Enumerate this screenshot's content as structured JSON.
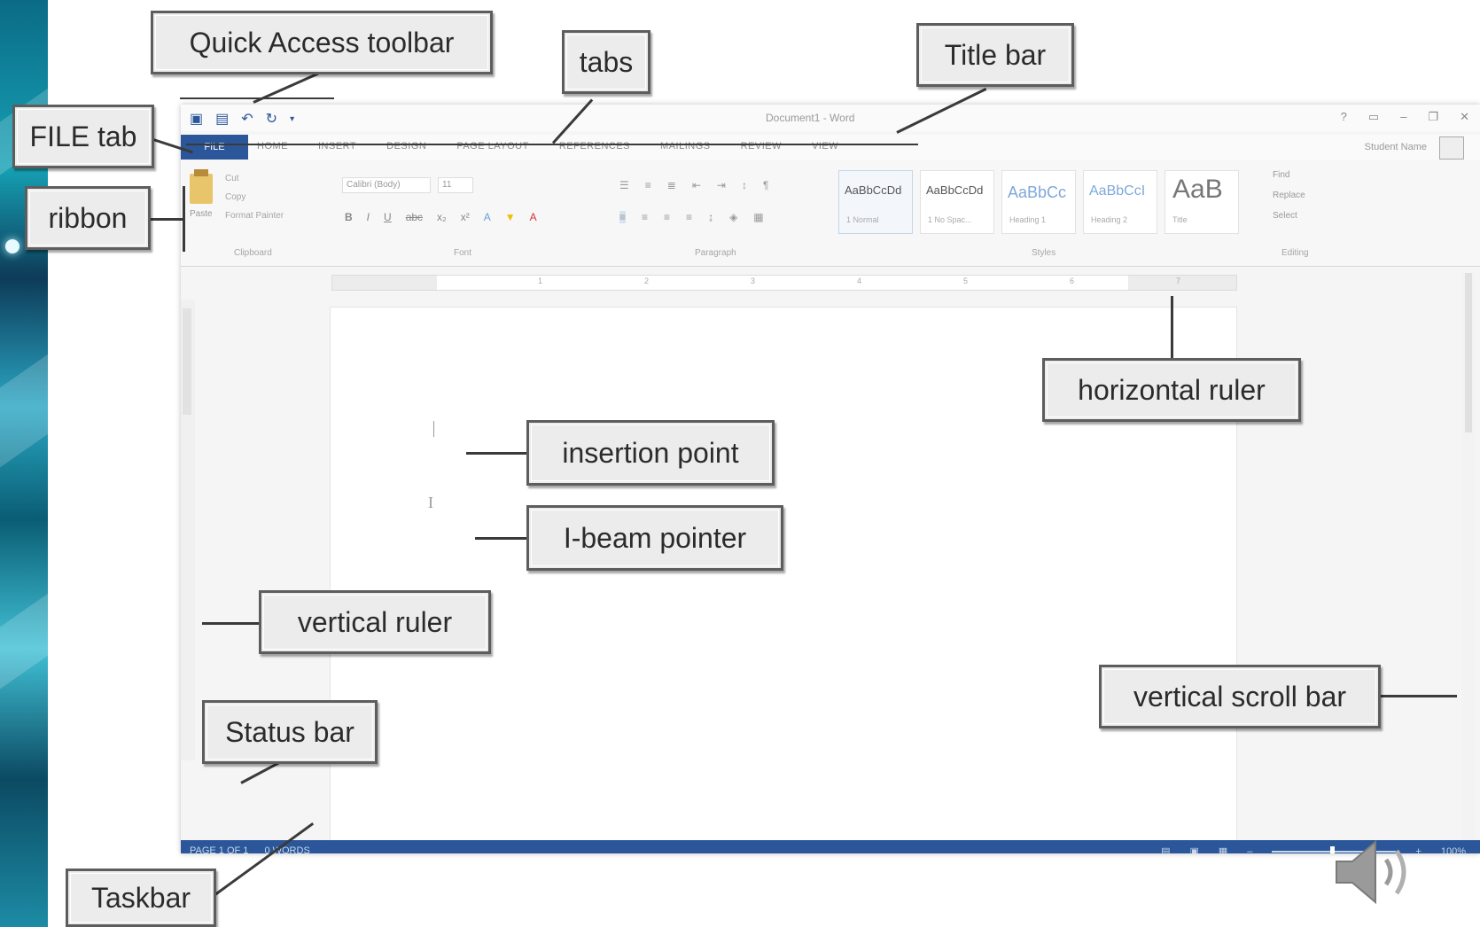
{
  "callouts": {
    "quick_access_toolbar": "Quick Access toolbar",
    "tabs": "tabs",
    "title_bar": "Title bar",
    "file_tab": "FILE tab",
    "ribbon": "ribbon",
    "horizontal_ruler": "horizontal ruler",
    "insertion_point": "insertion point",
    "ibeam_pointer": "I-beam pointer",
    "vertical_ruler": "vertical ruler",
    "vertical_scroll_bar": "vertical scroll bar",
    "status_bar": "Status bar",
    "taskbar": "Taskbar"
  },
  "word": {
    "title": "Document1 - Word",
    "file_tab": "FILE",
    "tabs": [
      "HOME",
      "INSERT",
      "DESIGN",
      "PAGE LAYOUT",
      "REFERENCES",
      "MAILINGS",
      "REVIEW",
      "VIEW"
    ],
    "user": "Student Name",
    "ribbon": {
      "paste": "Paste",
      "cut": "Cut",
      "copy": "Copy",
      "format_painter": "Format Painter",
      "font": "Calibri (Body)",
      "size": "11",
      "styles": [
        {
          "sample": "AaBbCcDd",
          "name": "1 Normal"
        },
        {
          "sample": "AaBbCcDd",
          "name": "1 No Spac..."
        },
        {
          "sample": "AaBbCc",
          "name": "Heading 1"
        },
        {
          "sample": "AaBbCcI",
          "name": "Heading 2"
        },
        {
          "sample": "AaB",
          "name": "Title"
        }
      ],
      "find": "Find",
      "replace": "Replace",
      "select": "Select",
      "groups": {
        "clipboard": "Clipboard",
        "font": "Font",
        "paragraph": "Paragraph",
        "styles": "Styles",
        "editing": "Editing"
      }
    },
    "ruler_numbers": [
      "1",
      "2",
      "3",
      "4",
      "5",
      "6",
      "7"
    ],
    "status": {
      "page": "PAGE 1 OF 1",
      "words": "0 WORDS",
      "zoom": "100%"
    }
  },
  "colors": {
    "word_blue": "#2b579a",
    "callout_bg": "#ececec",
    "callout_border": "#5d5d5d"
  }
}
